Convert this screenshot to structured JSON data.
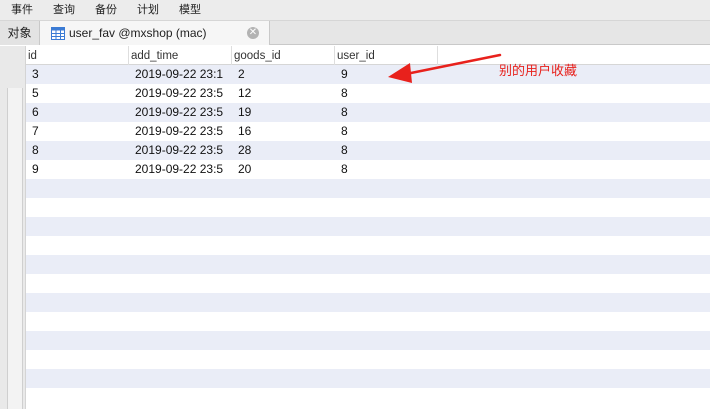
{
  "menu": [
    "事件",
    "查询",
    "备份",
    "计划",
    "模型"
  ],
  "tabs": {
    "objects": "对象",
    "active": "user_fav @mxshop (mac)"
  },
  "columns": [
    "id",
    "add_time",
    "goods_id",
    "user_id"
  ],
  "rows": [
    {
      "id": "3",
      "add_time": "2019-09-22 23:1",
      "goods_id": "2",
      "user_id": "9"
    },
    {
      "id": "5",
      "add_time": "2019-09-22 23:5",
      "goods_id": "12",
      "user_id": "8"
    },
    {
      "id": "6",
      "add_time": "2019-09-22 23:5",
      "goods_id": "19",
      "user_id": "8"
    },
    {
      "id": "7",
      "add_time": "2019-09-22 23:5",
      "goods_id": "16",
      "user_id": "8"
    },
    {
      "id": "8",
      "add_time": "2019-09-22 23:5",
      "goods_id": "28",
      "user_id": "8"
    },
    {
      "id": "9",
      "add_time": "2019-09-22 23:5",
      "goods_id": "20",
      "user_id": "8"
    }
  ],
  "annotation": "别的用户收藏",
  "colors": {
    "annotation": "#e8211c",
    "alt_row": "#eaedf7"
  }
}
